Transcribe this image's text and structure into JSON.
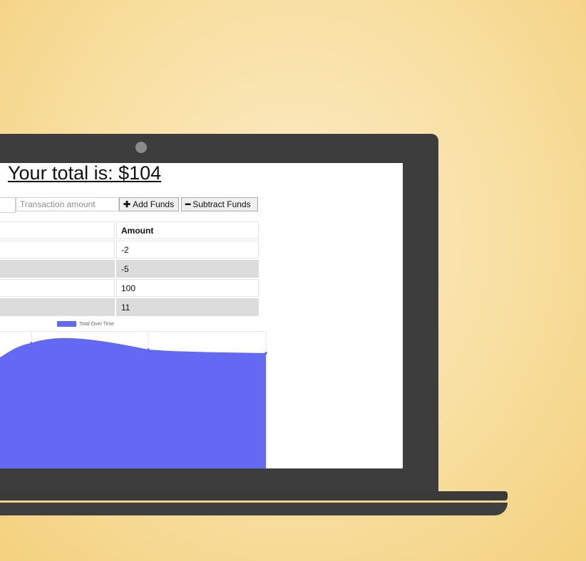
{
  "header": {
    "title": "Your total is: $104"
  },
  "form": {
    "name_placeholder": "",
    "amount_placeholder": "Transaction amount",
    "add_label": "Add Funds",
    "subtract_label": "Subtract Funds",
    "add_icon": "plus-icon",
    "subtract_icon": "minus-icon"
  },
  "table": {
    "headers": [
      "",
      "Amount"
    ],
    "rows": [
      {
        "name": "",
        "amount": "-2"
      },
      {
        "name": "",
        "amount": "-5"
      },
      {
        "name": "",
        "amount": "100"
      },
      {
        "name": "",
        "amount": "11"
      }
    ]
  },
  "chart_data": {
    "type": "area",
    "series": [
      {
        "name": "Total Over Time"
      }
    ],
    "colors": {
      "fill": "#6369f2",
      "grid": "#e6e6e6"
    }
  }
}
